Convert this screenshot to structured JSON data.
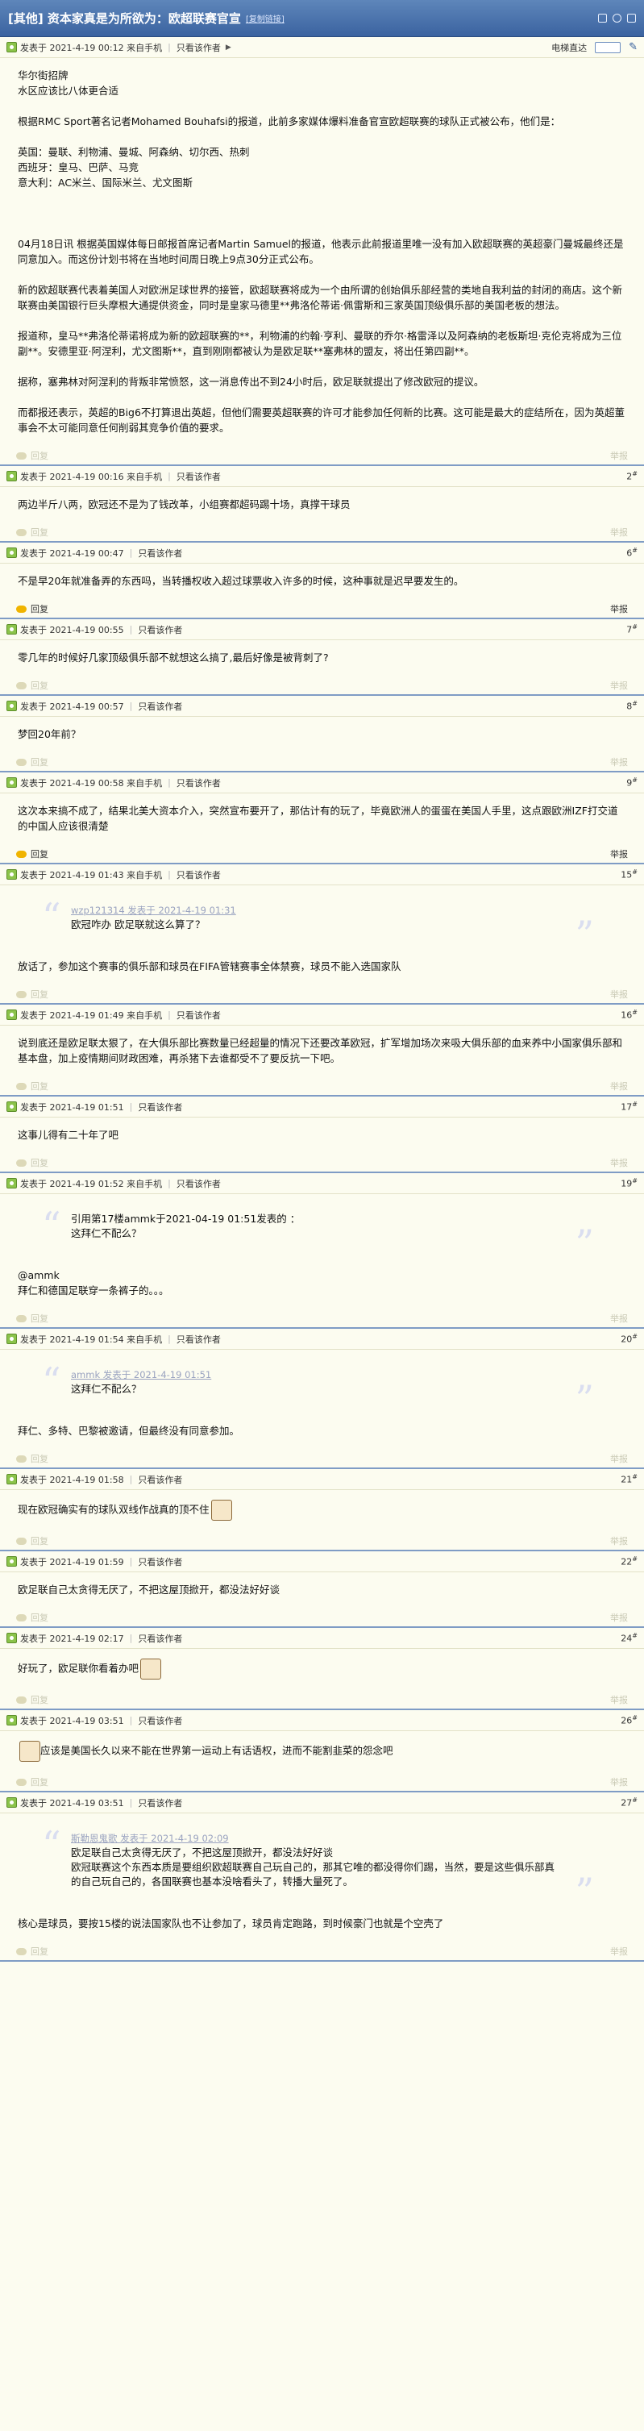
{
  "thread": {
    "title": "[其他] 资本家真是为所欲为：欧超联赛官宣",
    "copy_link": "[复制链接]"
  },
  "labels": {
    "only_author": "只看该作者",
    "prev_topic": "电梯直达",
    "reply": "回复",
    "report": "举报",
    "floor_suffix": "#"
  },
  "posts": [
    {
      "floor": "",
      "meta": "发表于 2021-4-19 00:12 来自手机",
      "body": [
        "华尔街招牌",
        "水区应该比八体更合适",
        "",
        "根据RMC Sport著名记者Mohamed Bouhafsi的报道，此前多家媒体爆料准备官宣欧超联赛的球队正式被公布，他们是：",
        "",
        "英国：曼联、利物浦、曼城、阿森纳、切尔西、热刺",
        "西班牙：皇马、巴萨、马竞",
        "意大利：AC米兰、国际米兰、尤文图斯",
        "",
        "",
        "",
        "04月18日讯 根据英国媒体每日邮报首席记者Martin Samuel的报道，他表示此前报道里唯一没有加入欧超联赛的英超豪门曼城最终还是同意加入。而这份计划书将在当地时间周日晚上9点30分正式公布。",
        "",
        "新的欧超联赛代表着美国人对欧洲足球世界的接管，欧超联赛将成为一个由所谓的创始俱乐部经营的类地自我利益的封闭的商店。这个新联赛由美国银行巨头摩根大通提供资金，同时是皇家马德里**弗洛伦蒂诺·佩雷斯和三家英国顶级俱乐部的美国老板的想法。",
        "",
        "报道称，皇马**弗洛伦蒂诺将成为新的欧超联赛的**，利物浦的约翰·亨利、曼联的乔尔·格雷泽以及阿森纳的老板斯坦·克伦克将成为三位副**。安德里亚·阿涅利，尤文图斯**，直到刚刚都被认为是欧足联**塞弗林的盟友，将出任第四副**。",
        "",
        "据称，塞弗林对阿涅利的背叛非常愤怒，这一消息传出不到24小时后，欧足联就提出了修改欧冠的提议。",
        "",
        "而都报还表示，英超的Big6不打算退出英超，但他们需要英超联赛的许可才能参加任何新的比赛。这可能是最大的症结所在，因为英超董事会不太可能同意任何削弱其竞争价值的要求。"
      ],
      "quote": null,
      "foot_active": false,
      "emoji": false
    },
    {
      "floor": "2",
      "meta": "发表于 2021-4-19 00:16 来自手机",
      "body": [
        "两边半斤八两，欧冠还不是为了钱改革，小组赛都超码踢十场，真撑干球员"
      ],
      "quote": null,
      "foot_active": false,
      "emoji": false
    },
    {
      "floor": "6",
      "meta": "发表于 2021-4-19 00:47",
      "body": [
        "不是早20年就准备弄的东西吗，当转播权收入超过球票收入许多的时候，这种事就是迟早要发生的。"
      ],
      "quote": null,
      "foot_active": true,
      "emoji": false
    },
    {
      "floor": "7",
      "meta": "发表于 2021-4-19 00:55",
      "body": [
        "零几年的时候好几家顶级俱乐部不就想这么搞了,最后好像是被背刺了?"
      ],
      "quote": null,
      "foot_active": false,
      "emoji": false
    },
    {
      "floor": "8",
      "meta": "发表于 2021-4-19 00:57",
      "body": [
        "梦回20年前？"
      ],
      "quote": null,
      "foot_active": false,
      "emoji": false
    },
    {
      "floor": "9",
      "meta": "发表于 2021-4-19 00:58 来自手机",
      "body": [
        "这次本来搞不成了，结果北美大资本介入，突然宣布要开了，那估计有的玩了，毕竟欧洲人的蛋蛋在美国人手里，这点跟欧洲IZF打交道的中国人应该很清楚"
      ],
      "quote": null,
      "foot_active": true,
      "emoji": false
    },
    {
      "floor": "15",
      "meta": "发表于 2021-4-19 01:43 来自手机",
      "quote": {
        "source": "wzp121314 发表于 2021-4-19 01:31",
        "text": "欧冠咋办 欧足联就这么算了？"
      },
      "body": [
        "",
        "放话了，参加这个赛事的俱乐部和球员在FIFA管辖赛事全体禁赛，球员不能入选国家队"
      ],
      "foot_active": false,
      "emoji": false
    },
    {
      "floor": "16",
      "meta": "发表于 2021-4-19 01:49 来自手机",
      "body": [
        "说到底还是欧足联太狠了，在大俱乐部比赛数量已经超量的情况下还要改革欧冠，扩军增加场次来吸大俱乐部的血来养中小国家俱乐部和基本盘，加上疫情期间财政困难，再杀猪下去谁都受不了要反抗一下吧。"
      ],
      "quote": null,
      "foot_active": false,
      "emoji": false
    },
    {
      "floor": "17",
      "meta": "发表于 2021-4-19 01:51",
      "body": [
        "这事儿得有二十年了吧"
      ],
      "quote": null,
      "foot_active": false,
      "emoji": false
    },
    {
      "floor": "19",
      "meta": "发表于 2021-4-19 01:52 来自手机",
      "quote": {
        "source": "",
        "text": "引用第17楼ammk于2021-04-19 01:51发表的 ：\n这拜仁不配么？"
      },
      "body": [
        "",
        "@ammk",
        "拜仁和德国足联穿一条裤子的。。。"
      ],
      "foot_active": false,
      "emoji": false
    },
    {
      "floor": "20",
      "meta": "发表于 2021-4-19 01:54 来自手机",
      "quote": {
        "source": "ammk 发表于 2021-4-19 01:51",
        "text": "这拜仁不配么？"
      },
      "body": [
        "",
        "拜仁、多特、巴黎被邀请，但最终没有同意参加。"
      ],
      "foot_active": false,
      "emoji": false
    },
    {
      "floor": "21",
      "meta": "发表于 2021-4-19 01:58",
      "body": [
        "现在欧冠确实有的球队双线作战真的顶不住"
      ],
      "quote": null,
      "foot_active": false,
      "emoji": true
    },
    {
      "floor": "22",
      "meta": "发表于 2021-4-19 01:59",
      "body": [
        "欧足联自己太贪得无厌了，不把这屋顶掀开，都没法好好谈"
      ],
      "quote": null,
      "foot_active": false,
      "emoji": false
    },
    {
      "floor": "24",
      "meta": "发表于 2021-4-19 02:17",
      "body": [
        "好玩了，欧足联你看着办吧"
      ],
      "quote": null,
      "foot_active": false,
      "emoji": true
    },
    {
      "floor": "26",
      "meta": "发表于 2021-4-19 03:51",
      "body": [
        "应该是美国长久以来不能在世界第一运动上有话语权，进而不能割韭菜的怨念吧"
      ],
      "quote": null,
      "foot_active": false,
      "emoji": false,
      "emoji_lead": true
    },
    {
      "floor": "27",
      "meta": "发表于 2021-4-19 03:51",
      "quote": {
        "source": "斯勒恩鬼歌 发表于 2021-4-19 02:09",
        "text": "欧足联自己太贪得无厌了，不把这屋顶掀开，都没法好好谈\n欧冠联赛这个东西本质是要组织欧超联赛自己玩自己的，那其它唯的都没得你们踢，当然，要是这些俱乐部真的自己玩自己的，各国联赛也基本没啥看头了，转播大量死了。"
      },
      "body": [
        "",
        "核心是球员，要按15楼的说法国家队也不让参加了，球员肯定跑路，到时候豪门也就是个空壳了"
      ],
      "foot_active": false,
      "emoji": false
    }
  ]
}
